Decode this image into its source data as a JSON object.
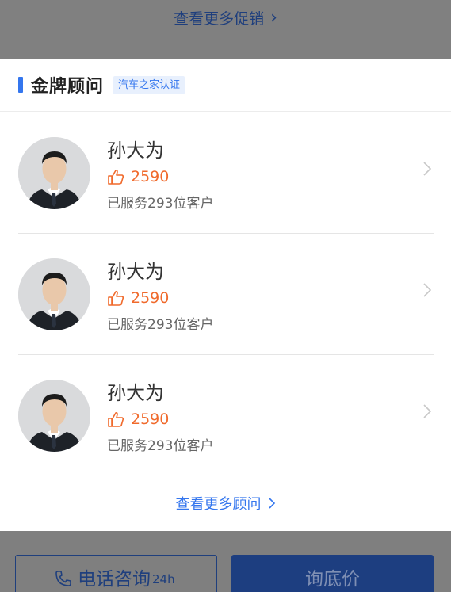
{
  "promo": {
    "more_label": "查看更多促销"
  },
  "section": {
    "title": "金牌顾问",
    "badge": "汽车之家认证"
  },
  "advisors": [
    {
      "name": "孙大为",
      "likes": "2590",
      "served": "已服务293位客户"
    },
    {
      "name": "孙大为",
      "likes": "2590",
      "served": "已服务293位客户"
    },
    {
      "name": "孙大为",
      "likes": "2590",
      "served": "已服务293位客户"
    }
  ],
  "more_advisors_label": "查看更多顾问",
  "bottom": {
    "phone_label": "电话咨询",
    "phone_suffix": "24h",
    "price_label": "询底价"
  },
  "colors": {
    "accent": "#3476ee",
    "likes": "#f06a2c",
    "dark_button": "#1d3e80"
  }
}
